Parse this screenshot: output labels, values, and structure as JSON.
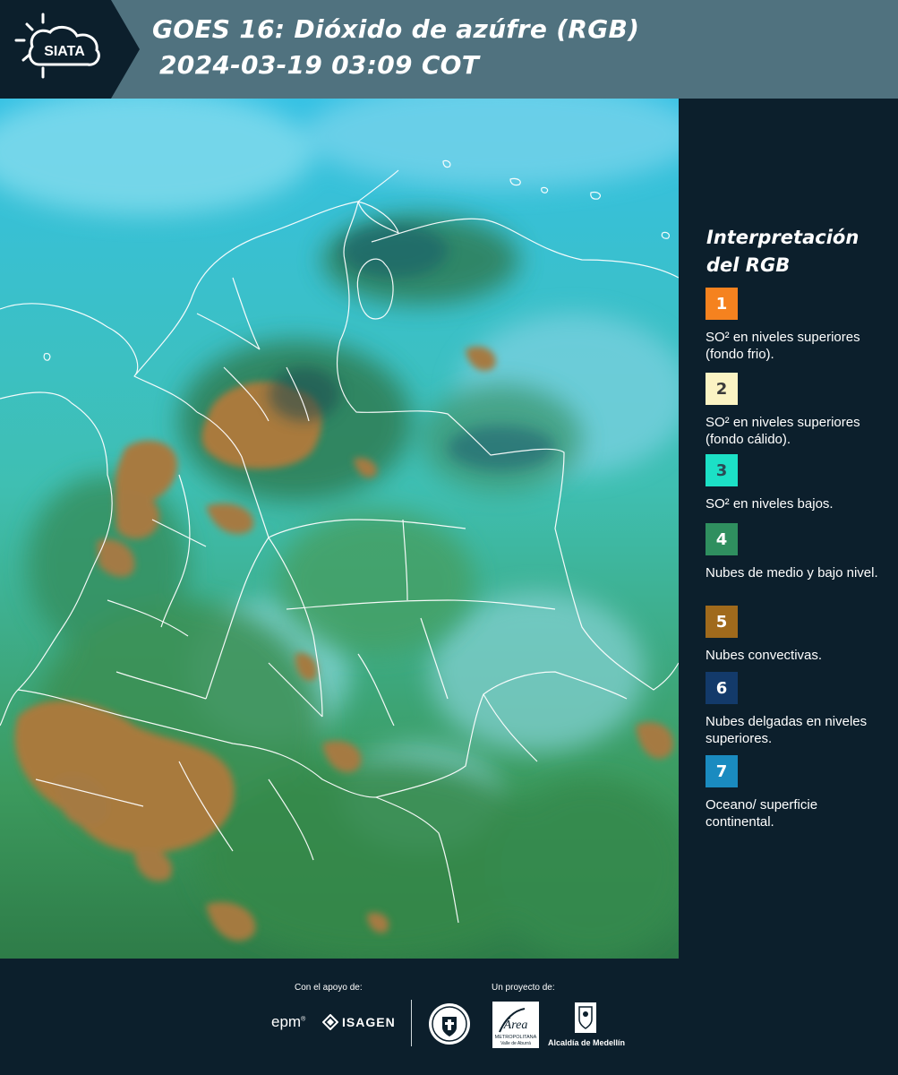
{
  "header": {
    "logo_text": "SIATA",
    "title_line1": "GOES 16: Dióxido de azúfre (RGB)",
    "title_line2": "2024-03-19 03:09 COT",
    "bar_color": "#50727f",
    "logo_bg_color": "#0c1f2c"
  },
  "map": {
    "description_icon": "satellite-map-colombia"
  },
  "legend": {
    "title_line1": "Interpretación",
    "title_line2": "del RGB",
    "items": [
      {
        "number": "1",
        "text": "SO² en niveles superiores (fondo frio).",
        "color": "#f5821f",
        "number_color": "#ffffff"
      },
      {
        "number": "2",
        "text": "SO² en niveles superiores (fondo cálido).",
        "color": "#fbf3c3",
        "number_color": "#3a3a3a"
      },
      {
        "number": "3",
        "text": "SO² en niveles bajos.",
        "color": "#1ce0c6",
        "number_color": "#2b4a55"
      },
      {
        "number": "4",
        "text": "Nubes de medio y bajo nivel.",
        "color": "#2f8f5f",
        "number_color": "#ffffff"
      },
      {
        "number": "5",
        "text": "Nubes convectivas.",
        "color": "#a06a1c",
        "number_color": "#ffffff"
      },
      {
        "number": "6",
        "text": "Nubes delgadas en niveles superiores.",
        "color": "#133a6a",
        "number_color": "#ffffff"
      },
      {
        "number": "7",
        "text": "Oceano/ superficie continental.",
        "color": "#1a8bc0",
        "number_color": "#ffffff"
      }
    ]
  },
  "footer": {
    "sponsor_caption": "Con el apoyo de:",
    "project_caption": "Un proyecto de:",
    "epm_label": "epm",
    "isagen_label": "ISAGEN",
    "area_label": "Área",
    "area_sub1": "METROPOLITANA",
    "area_sub2": "Valle de Aburrá",
    "alcaldia_label": "Alcaldía de Medellín"
  }
}
